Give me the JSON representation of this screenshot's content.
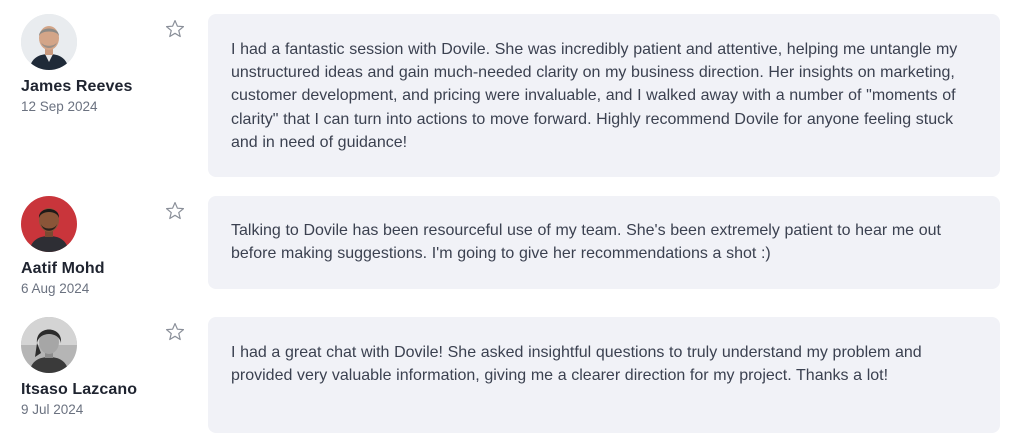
{
  "reviews": [
    {
      "author": "James Reeves",
      "date": "12 Sep 2024",
      "text": "I had a fantastic session with Dovile. She was incredibly patient and attentive, helping me untangle my unstructured ideas and gain much-needed clarity on my business direction. Her insights on marketing, customer development, and pricing were invaluable, and I walked away with a number of \"moments of clarity\" that I can turn into actions to move forward. Highly recommend Dovile for anyone feeling stuck and in need of guidance!",
      "avatar_bg": "#d9dde3",
      "favorite_icon": "star-outline-icon"
    },
    {
      "author": "Aatif Mohd",
      "date": "6 Aug 2024",
      "text": "Talking to Dovile has been resourceful use of my team. She's been extremely patient to hear me out before making suggestions. I'm going to give her recommendations a shot :)",
      "avatar_bg": "#c9353b",
      "favorite_icon": "star-outline-icon"
    },
    {
      "author": "Itsaso Lazcano",
      "date": "9 Jul 2024",
      "text": "I had a great chat with Dovile! She asked insightful questions to truly understand my problem and provided very valuable information, giving me a clearer direction for my project. Thanks a lot!",
      "avatar_bg": "#9a9a9a",
      "favorite_icon": "star-outline-icon"
    }
  ],
  "colors": {
    "bubble_bg": "#f1f2f7",
    "name_text": "#1f2430",
    "date_text": "#6b7280",
    "body_text": "#3b4150",
    "star_stroke": "#8a8f99"
  }
}
